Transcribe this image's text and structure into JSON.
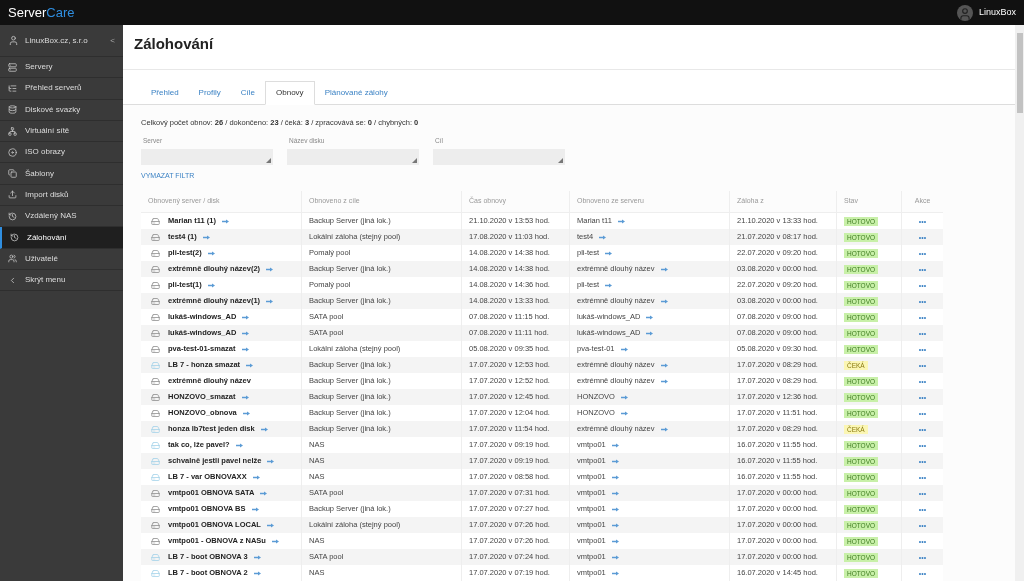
{
  "topbar": {
    "logo_main": "Server",
    "logo_accent": "Care",
    "user": "LinuxBox"
  },
  "sidebar": {
    "company": "LinuxBox.cz, s.r.o",
    "collapse_arrow": "<",
    "items": [
      {
        "label": "Servery",
        "kind": "servers",
        "selected": false
      },
      {
        "label": "Přehled serverů",
        "kind": "overview",
        "selected": false
      },
      {
        "label": "Diskové svazky",
        "kind": "volumes",
        "selected": false
      },
      {
        "label": "Virtuální sítě",
        "kind": "network",
        "selected": false
      },
      {
        "label": "ISO obrazy",
        "kind": "iso",
        "selected": false
      },
      {
        "label": "Šablony",
        "kind": "templates",
        "selected": false
      },
      {
        "label": "Import disků",
        "kind": "import",
        "selected": false
      },
      {
        "label": "Vzdálený NAS",
        "kind": "history",
        "selected": false
      },
      {
        "label": "Zálohování",
        "kind": "history",
        "selected": true
      },
      {
        "label": "Uživatelé",
        "kind": "users",
        "selected": false
      },
      {
        "label": "Skrýt menu",
        "kind": "collapse",
        "selected": false
      }
    ]
  },
  "page_title": "Zálohování",
  "tabs": [
    {
      "label": "Přehled",
      "selected": false
    },
    {
      "label": "Profily",
      "selected": false
    },
    {
      "label": "Cíle",
      "selected": false
    },
    {
      "label": "Obnovy",
      "selected": true
    },
    {
      "label": "Plánované zálohy",
      "selected": false
    }
  ],
  "summary": "Celkový počet obnov: **26** / dokončeno: **23** / čeká: **3** / zpracovává se: **0** / chybných: **0**",
  "filters": [
    {
      "label": "Server"
    },
    {
      "label": "Název disku"
    },
    {
      "label": "Cíl"
    }
  ],
  "clear_filter": "VYMAZAT FILTR",
  "table": {
    "columns": [
      "Obnovený server / disk",
      "Obnoveno z cíle",
      "Čas obnovy",
      "Obnoveno ze serveru",
      "Záloha z",
      "Stav",
      "Akce"
    ],
    "action_label": "•••",
    "rows": [
      {
        "kind": "disk",
        "name": "Marian t11 (1)",
        "name_link": true,
        "target": "Backup Server (jiná lok.)",
        "time": "21.10.2020 v 13:53 hod.",
        "source": "Marian t11",
        "source_link": true,
        "backup": "21.10.2020 v 13:33 hod.",
        "status": {
          "text": "HOTOVO",
          "kind": "done"
        }
      },
      {
        "kind": "disk",
        "name": "test4 (1)",
        "name_link": true,
        "target": "Lokální záloha (stejný pool)",
        "time": "17.08.2020 v 11:03 hod.",
        "source": "test4",
        "source_link": true,
        "backup": "21.07.2020 v 08:17 hod.",
        "status": {
          "text": "HOTOVO",
          "kind": "done"
        }
      },
      {
        "kind": "disk",
        "name": "pli-test(2)",
        "name_link": true,
        "target": "Pomalý pool",
        "time": "14.08.2020 v 14:38 hod.",
        "source": "pli-test",
        "source_link": true,
        "backup": "22.07.2020 v 09:20 hod.",
        "status": {
          "text": "HOTOVO",
          "kind": "done"
        }
      },
      {
        "kind": "disk",
        "name": "extrémně dlouhý název(2)",
        "name_link": true,
        "target": "Backup Server (jiná lok.)",
        "time": "14.08.2020 v 14:38 hod.",
        "source": "extrémně dlouhý název",
        "source_link": true,
        "backup": "03.08.2020 v 00:00 hod.",
        "status": {
          "text": "HOTOVO",
          "kind": "done"
        }
      },
      {
        "kind": "disk",
        "name": "pli-test(1)",
        "name_link": true,
        "target": "Pomalý pool",
        "time": "14.08.2020 v 14:36 hod.",
        "source": "pli-test",
        "source_link": true,
        "backup": "22.07.2020 v 09:20 hod.",
        "status": {
          "text": "HOTOVO",
          "kind": "done"
        }
      },
      {
        "kind": "disk",
        "name": "extrémně dlouhý název(1)",
        "name_link": true,
        "target": "Backup Server (jiná lok.)",
        "time": "14.08.2020 v 13:33 hod.",
        "source": "extrémně dlouhý název",
        "source_link": true,
        "backup": "03.08.2020 v 00:00 hod.",
        "status": {
          "text": "HOTOVO",
          "kind": "done"
        }
      },
      {
        "kind": "disk",
        "name": "lukáš-windows_AD",
        "name_link": true,
        "target": "SATA pool",
        "time": "07.08.2020 v 11:15 hod.",
        "source": "lukáš-windows_AD",
        "source_link": true,
        "backup": "07.08.2020 v 09:00 hod.",
        "status": {
          "text": "HOTOVO",
          "kind": "done"
        }
      },
      {
        "kind": "disk",
        "name": "lukáš-windows_AD",
        "name_link": true,
        "target": "SATA pool",
        "time": "07.08.2020 v 11:11 hod.",
        "source": "lukáš-windows_AD",
        "source_link": true,
        "backup": "07.08.2020 v 09:00 hod.",
        "status": {
          "text": "HOTOVO",
          "kind": "done"
        }
      },
      {
        "kind": "disk",
        "name": "pva-test-01-smazat",
        "name_link": true,
        "target": "Lokální záloha (stejný pool)",
        "time": "05.08.2020 v 09:35 hod.",
        "source": "pva-test-01",
        "source_link": true,
        "backup": "05.08.2020 v 09:30 hod.",
        "status": {
          "text": "HOTOVO",
          "kind": "done"
        }
      },
      {
        "kind": "virtual",
        "name": "LB 7 - honza smazat",
        "name_link": true,
        "target": "Backup Server (jiná lok.)",
        "time": "17.07.2020 v 12:53 hod.",
        "source": "extrémně dlouhý název",
        "source_link": true,
        "backup": "17.07.2020 v 08:29 hod.",
        "status": {
          "text": "ČEKÁ",
          "kind": "waiting"
        }
      },
      {
        "kind": "disk",
        "name": "extrémně dlouhý název",
        "name_link": false,
        "target": "Backup Server (jiná lok.)",
        "time": "17.07.2020 v 12:52 hod.",
        "source": "extrémně dlouhý název",
        "source_link": true,
        "backup": "17.07.2020 v 08:29 hod.",
        "status": {
          "text": "HOTOVO",
          "kind": "done"
        }
      },
      {
        "kind": "disk",
        "name": "HONZOVO_smazat",
        "name_link": true,
        "target": "Backup Server (jiná lok.)",
        "time": "17.07.2020 v 12:45 hod.",
        "source": "HONZOVO",
        "source_link": true,
        "backup": "17.07.2020 v 12:36 hod.",
        "status": {
          "text": "HOTOVO",
          "kind": "done"
        }
      },
      {
        "kind": "disk",
        "name": "HONZOVO_obnova",
        "name_link": true,
        "target": "Backup Server (jiná lok.)",
        "time": "17.07.2020 v 12:04 hod.",
        "source": "HONZOVO",
        "source_link": true,
        "backup": "17.07.2020 v 11:51 hod.",
        "status": {
          "text": "HOTOVO",
          "kind": "done"
        }
      },
      {
        "kind": "virtual",
        "name": "honza lb7test jeden disk",
        "name_link": true,
        "target": "Backup Server (jiná lok.)",
        "time": "17.07.2020 v 11:54 hod.",
        "source": "extrémně dlouhý název",
        "source_link": true,
        "backup": "17.07.2020 v 08:29 hod.",
        "status": {
          "text": "ČEKÁ",
          "kind": "waiting"
        }
      },
      {
        "kind": "virtual",
        "name": "tak co, lže pavel?",
        "name_link": true,
        "target": "NAS",
        "time": "17.07.2020 v 09:19 hod.",
        "source": "vmtpo01",
        "source_link": true,
        "backup": "16.07.2020 v 11:55 hod.",
        "status": {
          "text": "HOTOVO",
          "kind": "done"
        }
      },
      {
        "kind": "virtual",
        "name": "schvalně jestli pavel nelže",
        "name_link": true,
        "target": "NAS",
        "time": "17.07.2020 v 09:19 hod.",
        "source": "vmtpo01",
        "source_link": true,
        "backup": "16.07.2020 v 11:55 hod.",
        "status": {
          "text": "HOTOVO",
          "kind": "done"
        }
      },
      {
        "kind": "virtual",
        "name": "LB 7 - var OBNOVAXX",
        "name_link": true,
        "target": "NAS",
        "time": "17.07.2020 v 08:58 hod.",
        "source": "vmtpo01",
        "source_link": true,
        "backup": "16.07.2020 v 11:55 hod.",
        "status": {
          "text": "HOTOVO",
          "kind": "done"
        }
      },
      {
        "kind": "disk",
        "name": "vmtpo01 OBNOVA SATA",
        "name_link": true,
        "target": "SATA pool",
        "time": "17.07.2020 v 07:31 hod.",
        "source": "vmtpo01",
        "source_link": true,
        "backup": "17.07.2020 v 00:00 hod.",
        "status": {
          "text": "HOTOVO",
          "kind": "done"
        }
      },
      {
        "kind": "disk",
        "name": "vmtpo01 OBNOVA BS",
        "name_link": true,
        "target": "Backup Server (jiná lok.)",
        "time": "17.07.2020 v 07:27 hod.",
        "source": "vmtpo01",
        "source_link": true,
        "backup": "17.07.2020 v 00:00 hod.",
        "status": {
          "text": "HOTOVO",
          "kind": "done"
        }
      },
      {
        "kind": "disk",
        "name": "vmtpo01 OBNOVA LOCAL",
        "name_link": true,
        "target": "Lokální záloha (stejný pool)",
        "time": "17.07.2020 v 07:26 hod.",
        "source": "vmtpo01",
        "source_link": true,
        "backup": "17.07.2020 v 00:00 hod.",
        "status": {
          "text": "HOTOVO",
          "kind": "done"
        }
      },
      {
        "kind": "disk",
        "name": "vmtpo01 - OBNOVA z NASu",
        "name_link": true,
        "target": "NAS",
        "time": "17.07.2020 v 07:26 hod.",
        "source": "vmtpo01",
        "source_link": true,
        "backup": "17.07.2020 v 00:00 hod.",
        "status": {
          "text": "HOTOVO",
          "kind": "done"
        }
      },
      {
        "kind": "virtual",
        "name": "LB 7 - boot OBNOVA 3",
        "name_link": true,
        "target": "SATA pool",
        "time": "17.07.2020 v 07:24 hod.",
        "source": "vmtpo01",
        "source_link": true,
        "backup": "17.07.2020 v 00:00 hod.",
        "status": {
          "text": "HOTOVO",
          "kind": "done"
        }
      },
      {
        "kind": "virtual",
        "name": "LB 7 - boot OBNOVA 2",
        "name_link": true,
        "target": "NAS",
        "time": "17.07.2020 v 07:19 hod.",
        "source": "vmtpo01",
        "source_link": true,
        "backup": "16.07.2020 v 14:45 hod.",
        "status": {
          "text": "HOTOVO",
          "kind": "done"
        }
      }
    ]
  }
}
